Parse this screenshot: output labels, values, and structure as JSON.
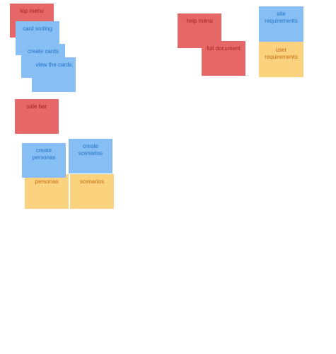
{
  "board": {
    "colors": {
      "red": "#e56767",
      "blue": "#87bff4",
      "yellow": "#fbd27e"
    },
    "notes": {
      "top_menu": "top menu",
      "card_sorting": "card sorting",
      "create_cards": "create cards",
      "view_the_cards": "view the cards",
      "side_bar": "side bar",
      "create_personas": "create personas",
      "create_scenarios": "create scenarios",
      "personas": "personas",
      "scenarios": "scenarios",
      "help_menu": "help menu",
      "full_document": "full document",
      "site_requirements": "site requirements",
      "user_requirements": "user requirements"
    }
  }
}
